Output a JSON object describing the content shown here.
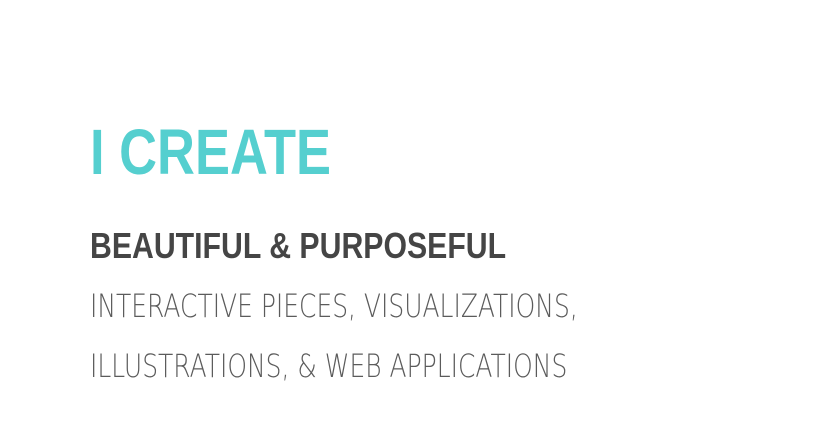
{
  "hero": {
    "headline": "I CREATE",
    "subheadline": "BEAUTIFUL & PURPOSEFUL",
    "line_3": "INTERACTIVE PIECES, VISUALIZATIONS,",
    "line_4": "ILLUSTRATIONS, & WEB APPLICATIONS"
  },
  "colors": {
    "accent": "#55cfcf",
    "dark_text": "#454545",
    "body_text": "#5b5b5b",
    "background": "#ffffff"
  }
}
